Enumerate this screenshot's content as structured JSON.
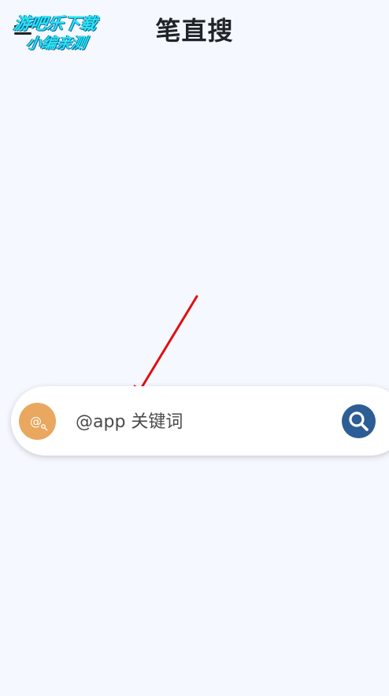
{
  "header": {
    "title": "笔直搜",
    "menu_icon": "hamburger-menu-icon"
  },
  "watermark": {
    "line1": "游吧乐下载",
    "line2": "小编亲测"
  },
  "search": {
    "engine_icon": "at-sign-icon",
    "placeholder": "@app 关键词",
    "value": "",
    "button_icon": "search-icon"
  },
  "annotation": {
    "type": "red-arrow",
    "color": "#e01010"
  },
  "colors": {
    "background": "#f5f8fe",
    "engine_icon_bg": "#e9a75f",
    "search_button_bg": "#2c5d95",
    "title": "#1f2428"
  }
}
